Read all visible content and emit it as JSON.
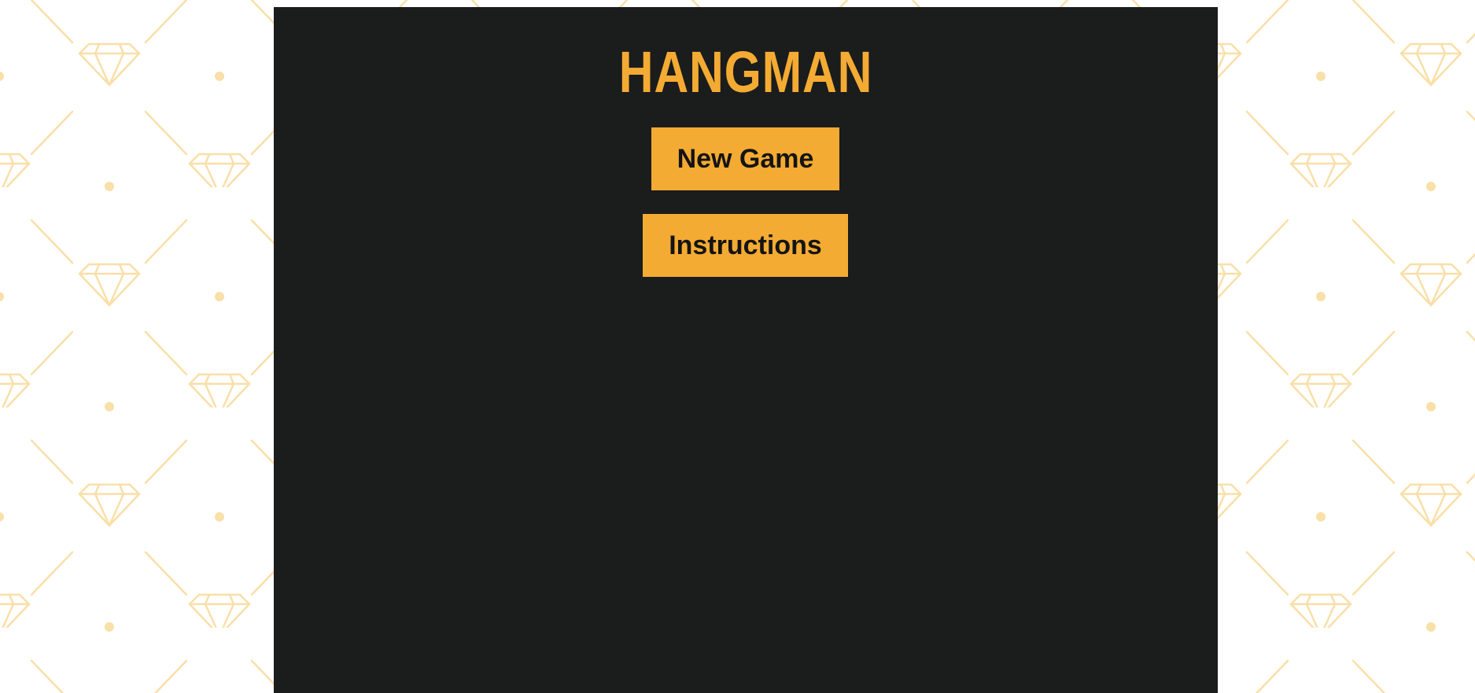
{
  "game": {
    "title": "HANGMAN"
  },
  "menu": {
    "new_game_label": "New Game",
    "instructions_label": "Instructions"
  },
  "theme": {
    "accent": "#f4ab33",
    "panel_bg": "#1b1c1c",
    "pattern": "#f9dfa8",
    "pattern_icon": "diamond-icon"
  }
}
